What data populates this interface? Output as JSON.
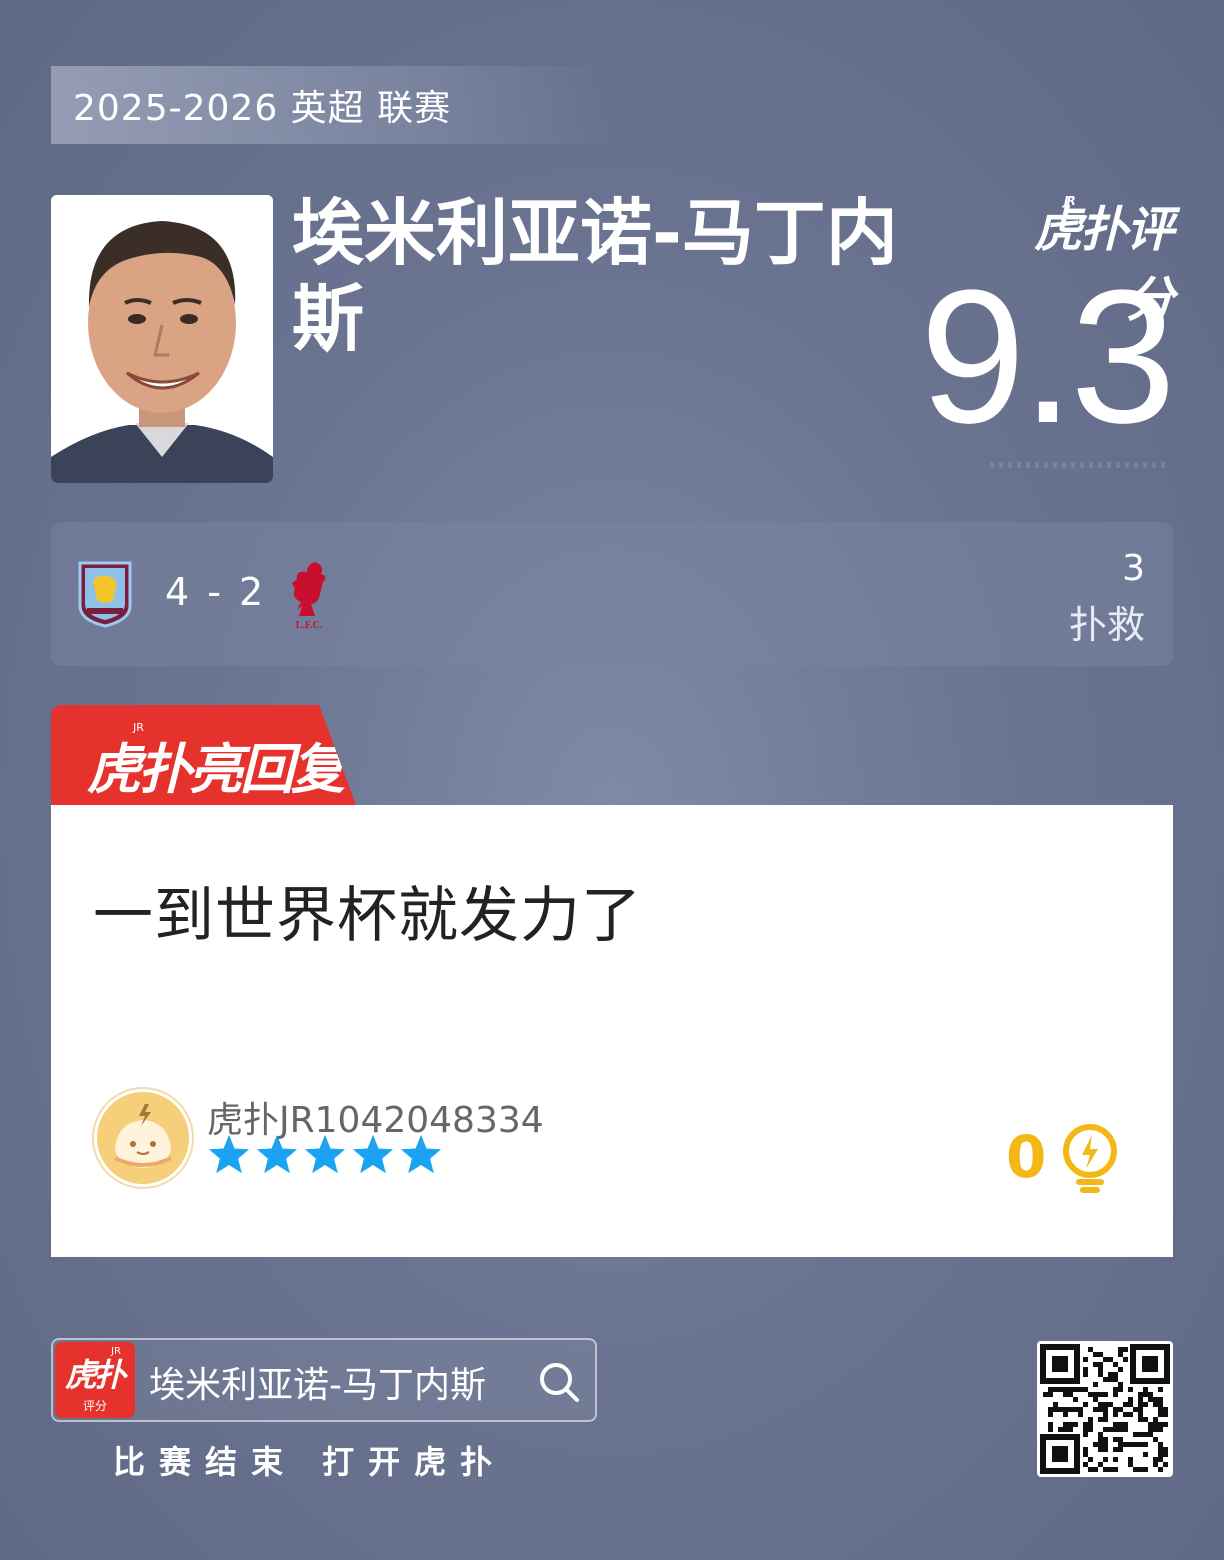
{
  "season": "2025-2026 英超 联赛",
  "player": {
    "name": "埃米利亚诺-马丁内斯"
  },
  "rating": {
    "logo": "虎扑评分",
    "logo_sup": "JR",
    "value": "9.3"
  },
  "match": {
    "home_team": "ASTON VILLA",
    "score": "4 - 2",
    "away_team": "L.F.C.",
    "stat_value": "3",
    "stat_label": "扑救"
  },
  "highlight": {
    "tab_label": "虎扑亮回复",
    "tab_sup": "JR"
  },
  "reply": {
    "text": "一到世界杯就发力了",
    "username": "虎扑JR1042048334",
    "stars": 5,
    "likes": "0"
  },
  "footer": {
    "app_name": "虎扑",
    "app_sup": "JR",
    "app_sub": "评分",
    "search_text": "埃米利亚诺-马丁内斯",
    "cta": "比赛结束  打开虎扑"
  },
  "colors": {
    "accent_red": "#e5322d",
    "star_blue": "#1aa3f0",
    "like_gold": "#f3b716"
  },
  "icons": [
    "aston-villa-crest-icon",
    "liverpool-crest-icon",
    "star-icon",
    "lightbulb-icon",
    "search-icon",
    "qr-code-icon"
  ]
}
